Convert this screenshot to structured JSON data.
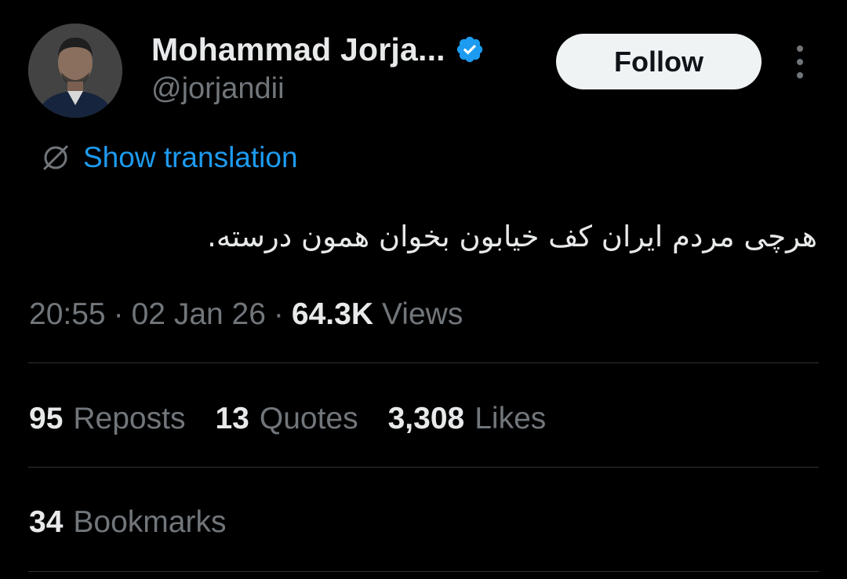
{
  "author": {
    "display_name": "Mohammad Jorja...",
    "handle": "@jorjandii",
    "verified": true,
    "avatar_icon": "profile-photo"
  },
  "actions": {
    "follow_label": "Follow",
    "more_icon": "more-vertical-icon"
  },
  "translation": {
    "label": "Show translation",
    "icon": "translate-icon"
  },
  "tweet": {
    "text": "هرچی مردم ایران کف خیابون بخوان همون درسته."
  },
  "meta": {
    "time": "20:55",
    "separator": "·",
    "date": "02 Jan 26",
    "views_count": "64.3K",
    "views_label": "Views"
  },
  "stats": {
    "reposts": {
      "count": "95",
      "label": "Reposts"
    },
    "quotes": {
      "count": "13",
      "label": "Quotes"
    },
    "likes": {
      "count": "3,308",
      "label": "Likes"
    },
    "bookmarks": {
      "count": "34",
      "label": "Bookmarks"
    }
  },
  "colors": {
    "background": "#000000",
    "primary_text": "#e7e9ea",
    "secondary_text": "#71767b",
    "link": "#1d9bf0",
    "verified_badge": "#1d9bf0",
    "divider": "#2f3336",
    "follow_button_bg": "#eff3f4"
  }
}
